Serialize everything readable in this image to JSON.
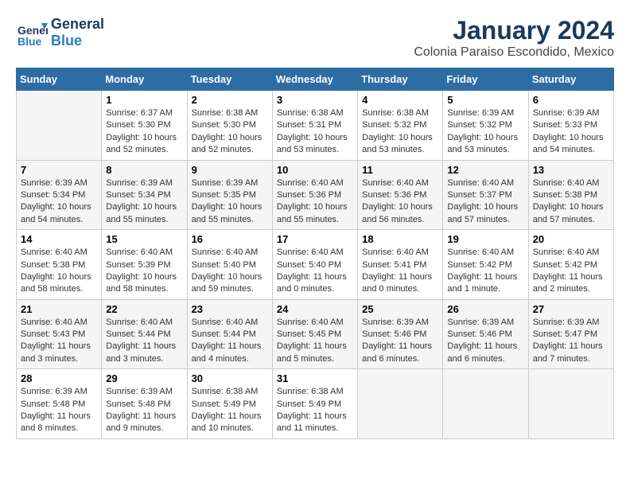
{
  "header": {
    "logo_line1": "General",
    "logo_line2": "Blue",
    "title": "January 2024",
    "subtitle": "Colonia Paraiso Escondido, Mexico"
  },
  "days_of_week": [
    "Sunday",
    "Monday",
    "Tuesday",
    "Wednesday",
    "Thursday",
    "Friday",
    "Saturday"
  ],
  "weeks": [
    [
      {
        "day": "",
        "info": ""
      },
      {
        "day": "1",
        "info": "Sunrise: 6:37 AM\nSunset: 5:30 PM\nDaylight: 10 hours\nand 52 minutes."
      },
      {
        "day": "2",
        "info": "Sunrise: 6:38 AM\nSunset: 5:30 PM\nDaylight: 10 hours\nand 52 minutes."
      },
      {
        "day": "3",
        "info": "Sunrise: 6:38 AM\nSunset: 5:31 PM\nDaylight: 10 hours\nand 53 minutes."
      },
      {
        "day": "4",
        "info": "Sunrise: 6:38 AM\nSunset: 5:32 PM\nDaylight: 10 hours\nand 53 minutes."
      },
      {
        "day": "5",
        "info": "Sunrise: 6:39 AM\nSunset: 5:32 PM\nDaylight: 10 hours\nand 53 minutes."
      },
      {
        "day": "6",
        "info": "Sunrise: 6:39 AM\nSunset: 5:33 PM\nDaylight: 10 hours\nand 54 minutes."
      }
    ],
    [
      {
        "day": "7",
        "info": "Sunrise: 6:39 AM\nSunset: 5:34 PM\nDaylight: 10 hours\nand 54 minutes."
      },
      {
        "day": "8",
        "info": "Sunrise: 6:39 AM\nSunset: 5:34 PM\nDaylight: 10 hours\nand 55 minutes."
      },
      {
        "day": "9",
        "info": "Sunrise: 6:39 AM\nSunset: 5:35 PM\nDaylight: 10 hours\nand 55 minutes."
      },
      {
        "day": "10",
        "info": "Sunrise: 6:40 AM\nSunset: 5:36 PM\nDaylight: 10 hours\nand 55 minutes."
      },
      {
        "day": "11",
        "info": "Sunrise: 6:40 AM\nSunset: 5:36 PM\nDaylight: 10 hours\nand 56 minutes."
      },
      {
        "day": "12",
        "info": "Sunrise: 6:40 AM\nSunset: 5:37 PM\nDaylight: 10 hours\nand 57 minutes."
      },
      {
        "day": "13",
        "info": "Sunrise: 6:40 AM\nSunset: 5:38 PM\nDaylight: 10 hours\nand 57 minutes."
      }
    ],
    [
      {
        "day": "14",
        "info": "Sunrise: 6:40 AM\nSunset: 5:38 PM\nDaylight: 10 hours\nand 58 minutes."
      },
      {
        "day": "15",
        "info": "Sunrise: 6:40 AM\nSunset: 5:39 PM\nDaylight: 10 hours\nand 58 minutes."
      },
      {
        "day": "16",
        "info": "Sunrise: 6:40 AM\nSunset: 5:40 PM\nDaylight: 10 hours\nand 59 minutes."
      },
      {
        "day": "17",
        "info": "Sunrise: 6:40 AM\nSunset: 5:40 PM\nDaylight: 11 hours\nand 0 minutes."
      },
      {
        "day": "18",
        "info": "Sunrise: 6:40 AM\nSunset: 5:41 PM\nDaylight: 11 hours\nand 0 minutes."
      },
      {
        "day": "19",
        "info": "Sunrise: 6:40 AM\nSunset: 5:42 PM\nDaylight: 11 hours\nand 1 minute."
      },
      {
        "day": "20",
        "info": "Sunrise: 6:40 AM\nSunset: 5:42 PM\nDaylight: 11 hours\nand 2 minutes."
      }
    ],
    [
      {
        "day": "21",
        "info": "Sunrise: 6:40 AM\nSunset: 5:43 PM\nDaylight: 11 hours\nand 3 minutes."
      },
      {
        "day": "22",
        "info": "Sunrise: 6:40 AM\nSunset: 5:44 PM\nDaylight: 11 hours\nand 3 minutes."
      },
      {
        "day": "23",
        "info": "Sunrise: 6:40 AM\nSunset: 5:44 PM\nDaylight: 11 hours\nand 4 minutes."
      },
      {
        "day": "24",
        "info": "Sunrise: 6:40 AM\nSunset: 5:45 PM\nDaylight: 11 hours\nand 5 minutes."
      },
      {
        "day": "25",
        "info": "Sunrise: 6:39 AM\nSunset: 5:46 PM\nDaylight: 11 hours\nand 6 minutes."
      },
      {
        "day": "26",
        "info": "Sunrise: 6:39 AM\nSunset: 5:46 PM\nDaylight: 11 hours\nand 6 minutes."
      },
      {
        "day": "27",
        "info": "Sunrise: 6:39 AM\nSunset: 5:47 PM\nDaylight: 11 hours\nand 7 minutes."
      }
    ],
    [
      {
        "day": "28",
        "info": "Sunrise: 6:39 AM\nSunset: 5:48 PM\nDaylight: 11 hours\nand 8 minutes."
      },
      {
        "day": "29",
        "info": "Sunrise: 6:39 AM\nSunset: 5:48 PM\nDaylight: 11 hours\nand 9 minutes."
      },
      {
        "day": "30",
        "info": "Sunrise: 6:38 AM\nSunset: 5:49 PM\nDaylight: 11 hours\nand 10 minutes."
      },
      {
        "day": "31",
        "info": "Sunrise: 6:38 AM\nSunset: 5:49 PM\nDaylight: 11 hours\nand 11 minutes."
      },
      {
        "day": "",
        "info": ""
      },
      {
        "day": "",
        "info": ""
      },
      {
        "day": "",
        "info": ""
      }
    ]
  ]
}
